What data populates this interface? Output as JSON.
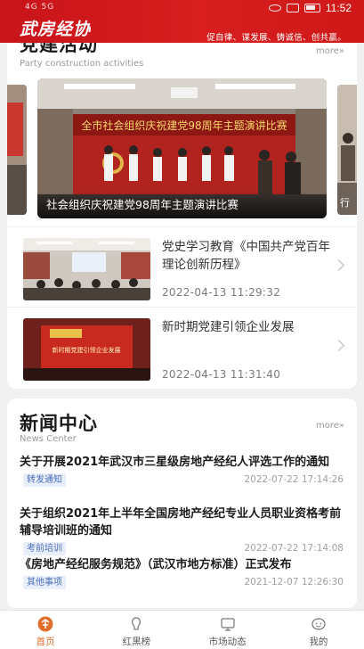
{
  "status_bar": {
    "carrier": "4G 5G",
    "time": "11:52"
  },
  "header": {
    "logo": "武房经协",
    "slogan": "促自律、谋发展、铸诚信、创共赢。"
  },
  "party_section": {
    "title": "党建活动",
    "subtitle": "Party construction activities",
    "more": "more»",
    "banner": {
      "caption": "社会组织庆祝建党98周年主题演讲比赛",
      "stage_text": "全市社会组织庆祝建党98周年主题演讲比赛",
      "right_caption": "行"
    },
    "items": [
      {
        "title": "党史学习教育《中国共产党百年理论创新历程》",
        "date": "2022-04-13 11:29:32"
      },
      {
        "title": "新时期党建引领企业发展",
        "date": "2022-04-13 11:31:40",
        "screen_text": "新时期党建引领企业发展"
      }
    ]
  },
  "news_section": {
    "title": "新闻中心",
    "subtitle": "News Center",
    "more": "more»",
    "items": [
      {
        "title": "关于开展2021年武汉市三星级房地产经纪人评选工作的通知",
        "tag": "转发通知",
        "date": "2022-07-22 17:14:26"
      },
      {
        "title": "关于组织2021年上半年全国房地产经纪专业人员职业资格考前辅导培训班的通知",
        "tag": "考前培训",
        "date": "2022-07-22 17:14:08"
      },
      {
        "title": "《房地产经纪服务规范》（武汉市地方标准）正式发布",
        "tag": "其他事项",
        "date": "2021-12-07 12:26:30"
      }
    ]
  },
  "bottom_nav": [
    {
      "label": "首页",
      "icon": "home-icon",
      "active": true
    },
    {
      "label": "红黑榜",
      "icon": "ranking-icon",
      "active": false
    },
    {
      "label": "市场动态",
      "icon": "market-icon",
      "active": false
    },
    {
      "label": "我的",
      "icon": "profile-icon",
      "active": false
    }
  ],
  "colors": {
    "header_red": "#d21a1c",
    "active_orange": "#e36f2c",
    "tag_bg": "#e9eefb",
    "tag_text": "#4b6fb7"
  }
}
